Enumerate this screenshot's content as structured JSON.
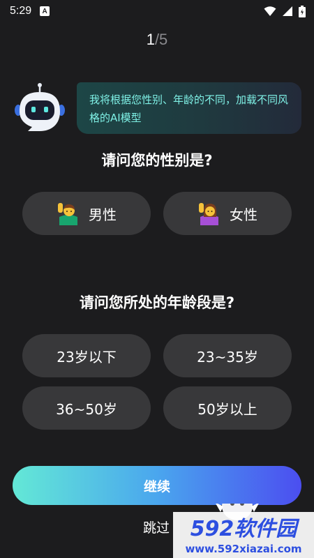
{
  "status_bar": {
    "time": "5:29",
    "notification_badge": "A",
    "icons": [
      "wifi-icon",
      "cell-signal-icon",
      "battery-icon"
    ]
  },
  "progress": {
    "current": "1",
    "rest": "/5"
  },
  "bot_message": "我将根据您性别、年龄的不同，加载不同风格的AI模型",
  "gender_question": "请问您的性别是?",
  "gender_options": [
    {
      "label": "男性",
      "icon": "man-raising-hand-icon"
    },
    {
      "label": "女性",
      "icon": "woman-raising-hand-icon"
    }
  ],
  "age_question": "请问您所处的年龄段是?",
  "age_options": [
    "23岁以下",
    "23~35岁",
    "36~50岁",
    "50岁以上"
  ],
  "continue_label": "继续",
  "skip_label": "跳过",
  "watermark": {
    "brand": "592软件园",
    "url": "www.592xiazai.com"
  },
  "colors": {
    "background": "#1c1c1e",
    "button": "#38383a",
    "bubble_text": "#7ff1e6",
    "gradient_start": "#63e8d6",
    "gradient_end": "#4b4ef0",
    "watermark_blue": "#2d4fe0"
  }
}
